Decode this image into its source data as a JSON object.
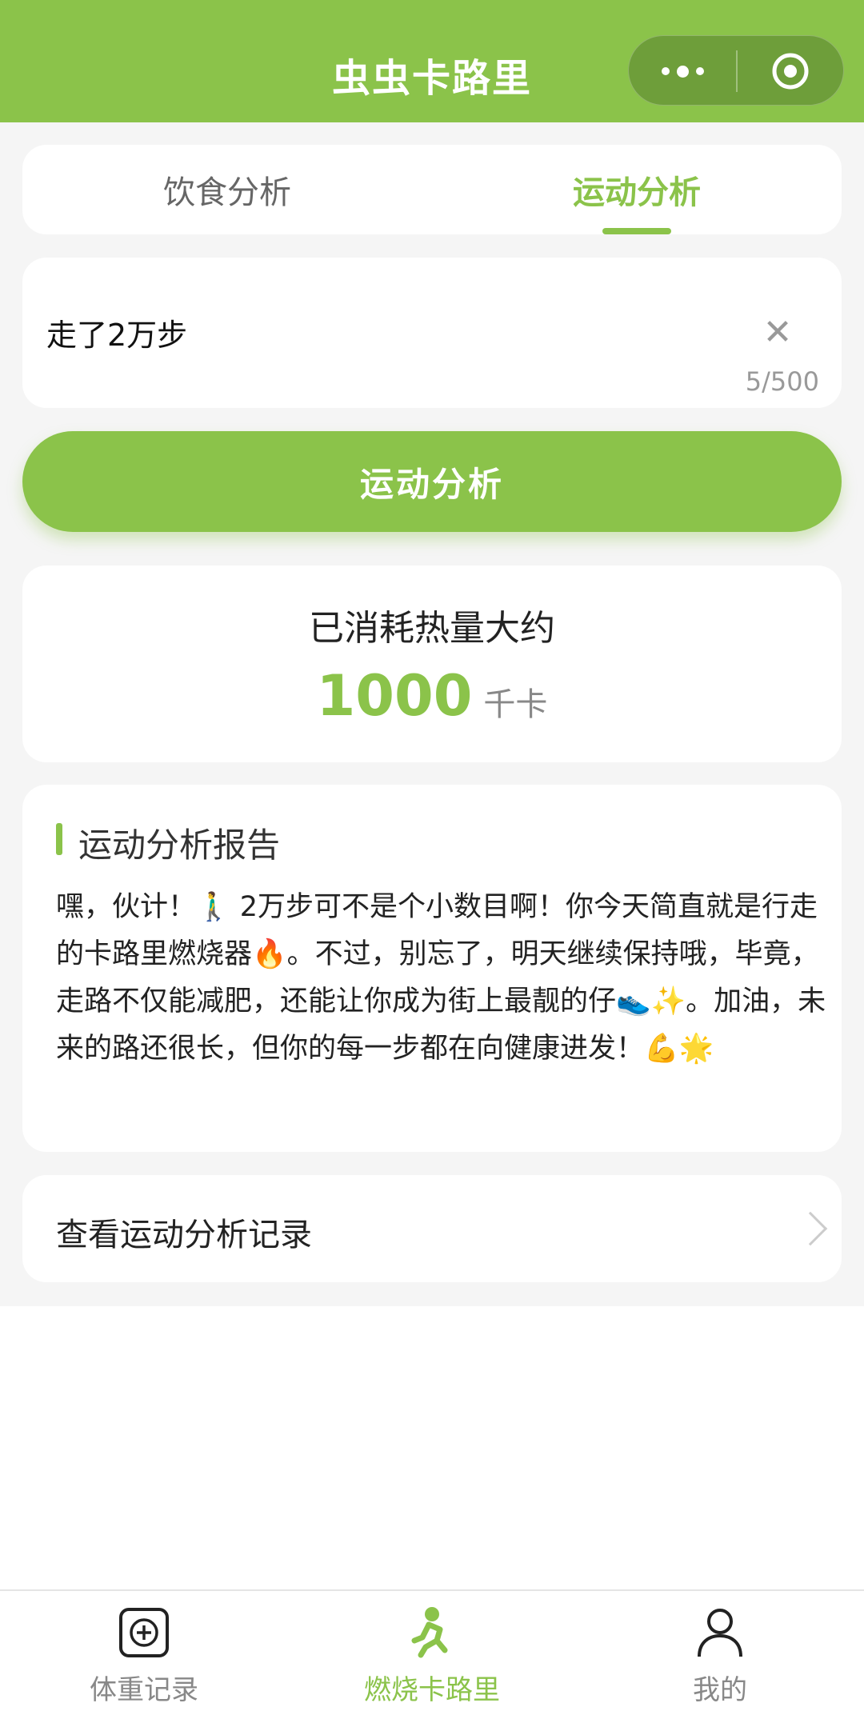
{
  "header": {
    "title": "虫虫卡路里",
    "more_icon": "more-dots-icon",
    "target_icon": "target-icon"
  },
  "tabs": [
    {
      "label": "饮食分析",
      "active": false
    },
    {
      "label": "运动分析",
      "active": true
    }
  ],
  "input": {
    "value": "走了2万步",
    "counter": "5/500",
    "clear_icon": "close-icon"
  },
  "analyze_button": {
    "label": "运动分析"
  },
  "result": {
    "label": "已消耗热量大约",
    "value": "1000",
    "unit": "千卡"
  },
  "report": {
    "title": "运动分析报告",
    "body": "嘿，伙计！🚶‍♂️ 2万步可不是个小数目啊！你今天简直就是行走的卡路里燃烧器🔥。不过，别忘了，明天继续保持哦，毕竟，走路不仅能减肥，还能让你成为街上最靓的仔👟✨。加油，未来的路还很长，但你的每一步都在向健康进发！💪🌟"
  },
  "history": {
    "label": "查看运动分析记录",
    "icon": "chevron-right-icon"
  },
  "tabbar": [
    {
      "label": "体重记录",
      "icon": "plus-square-icon",
      "active": false
    },
    {
      "label": "燃烧卡路里",
      "icon": "runner-icon",
      "active": true
    },
    {
      "label": "我的",
      "icon": "user-icon",
      "active": false
    }
  ],
  "colors": {
    "accent": "#8bc34a",
    "background": "#f5f5f5"
  }
}
